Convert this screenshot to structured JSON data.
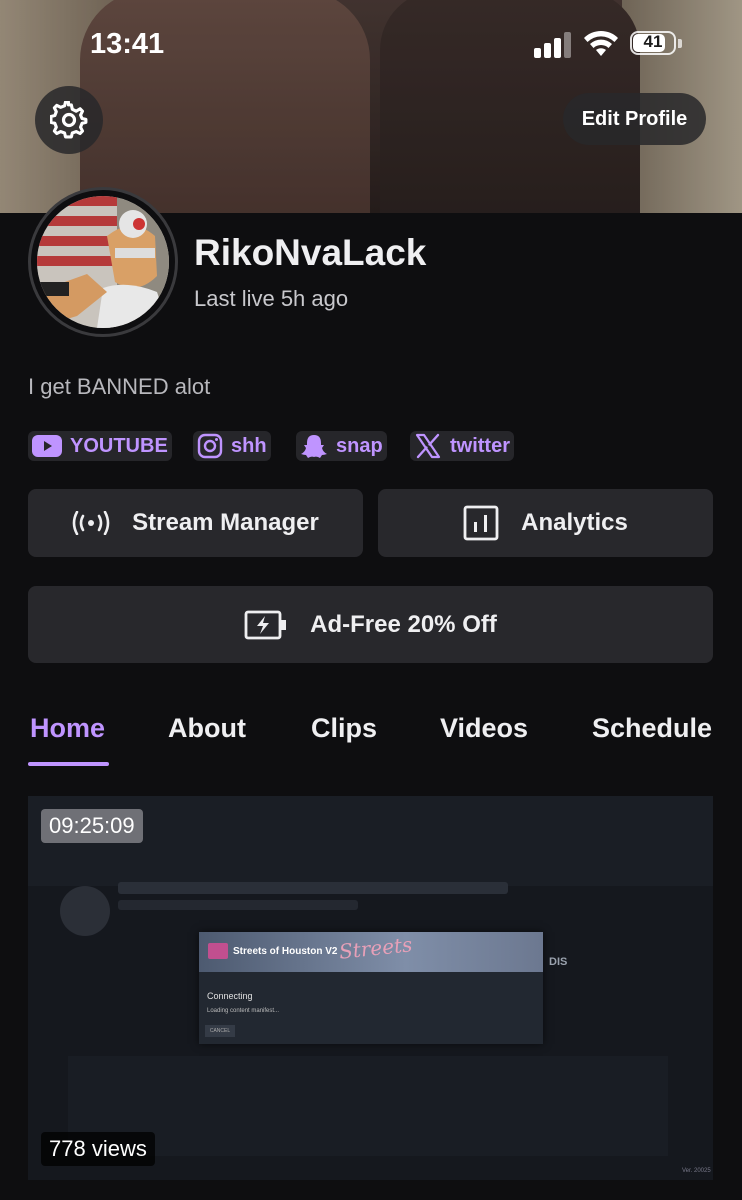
{
  "status_bar": {
    "time": "13:41",
    "battery_level": "41"
  },
  "header": {
    "edit_profile_label": "Edit Profile"
  },
  "profile": {
    "username": "RikoNvaLack",
    "last_live": "Last live 5h ago",
    "bio": "I get BANNED alot"
  },
  "social_links": [
    {
      "label": "YOUTUBE",
      "icon": "youtube-icon"
    },
    {
      "label": "shh",
      "icon": "instagram-icon"
    },
    {
      "label": "snap",
      "icon": "snapchat-icon"
    },
    {
      "label": "twitter",
      "icon": "x-icon"
    }
  ],
  "actions": {
    "stream_manager": "Stream Manager",
    "analytics": "Analytics",
    "ad_free": "Ad-Free 20% Off"
  },
  "tabs": [
    {
      "label": "Home",
      "active": true
    },
    {
      "label": "About",
      "active": false
    },
    {
      "label": "Clips",
      "active": false
    },
    {
      "label": "Videos",
      "active": false
    },
    {
      "label": "Schedule",
      "active": false
    }
  ],
  "video": {
    "duration": "09:25:09",
    "views": "778 views",
    "thumbnail": {
      "dialog_title": "Streets of Houston V2",
      "status": "Connecting",
      "substatus": "Loading content manifest...",
      "cancel": "CANCEL",
      "side_text": "DIS",
      "version": "Ver. 20025"
    }
  },
  "colors": {
    "accent": "#bf94ff",
    "background": "#0e0e10",
    "button_bg": "#28282c"
  }
}
